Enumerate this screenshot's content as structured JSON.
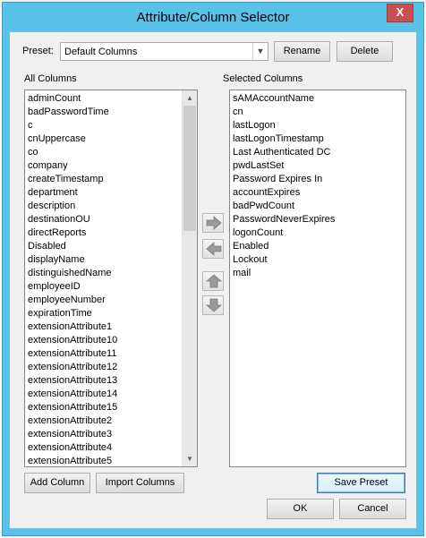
{
  "dialog": {
    "title": "Attribute/Column Selector",
    "close_glyph": "X"
  },
  "preset": {
    "label": "Preset:",
    "value": "Default Columns",
    "rename_label": "Rename",
    "delete_label": "Delete"
  },
  "all_columns": {
    "label": "All Columns",
    "items": [
      "adminCount",
      "badPasswordTime",
      "c",
      "cnUppercase",
      "co",
      "company",
      "createTimestamp",
      "department",
      "description",
      "destinationOU",
      "directReports",
      "Disabled",
      "displayName",
      "distinguishedName",
      "employeeID",
      "employeeNumber",
      "expirationTime",
      "extensionAttribute1",
      "extensionAttribute10",
      "extensionAttribute11",
      "extensionAttribute12",
      "extensionAttribute13",
      "extensionAttribute14",
      "extensionAttribute15",
      "extensionAttribute2",
      "extensionAttribute3",
      "extensionAttribute4",
      "extensionAttribute5"
    ]
  },
  "selected_columns": {
    "label": "Selected Columns",
    "items": [
      "sAMAccountName",
      "cn",
      "lastLogon",
      "lastLogonTimestamp",
      "Last Authenticated DC",
      "pwdLastSet",
      "Password Expires In",
      "accountExpires",
      "badPwdCount",
      "PasswordNeverExpires",
      "logonCount",
      "Enabled",
      "Lockout",
      "mail"
    ]
  },
  "actions": {
    "add_column_label": "Add Column",
    "import_columns_label": "Import Columns",
    "save_preset_label": "Save Preset",
    "ok_label": "OK",
    "cancel_label": "Cancel"
  },
  "icons": {
    "move_right": "arrow-right-icon",
    "move_left": "arrow-left-icon",
    "move_up": "arrow-up-icon",
    "move_down": "arrow-down-icon"
  },
  "colors": {
    "window_frame": "#58c2e8",
    "close_button": "#c75050",
    "arrow_fill": "#9a9a9a"
  }
}
